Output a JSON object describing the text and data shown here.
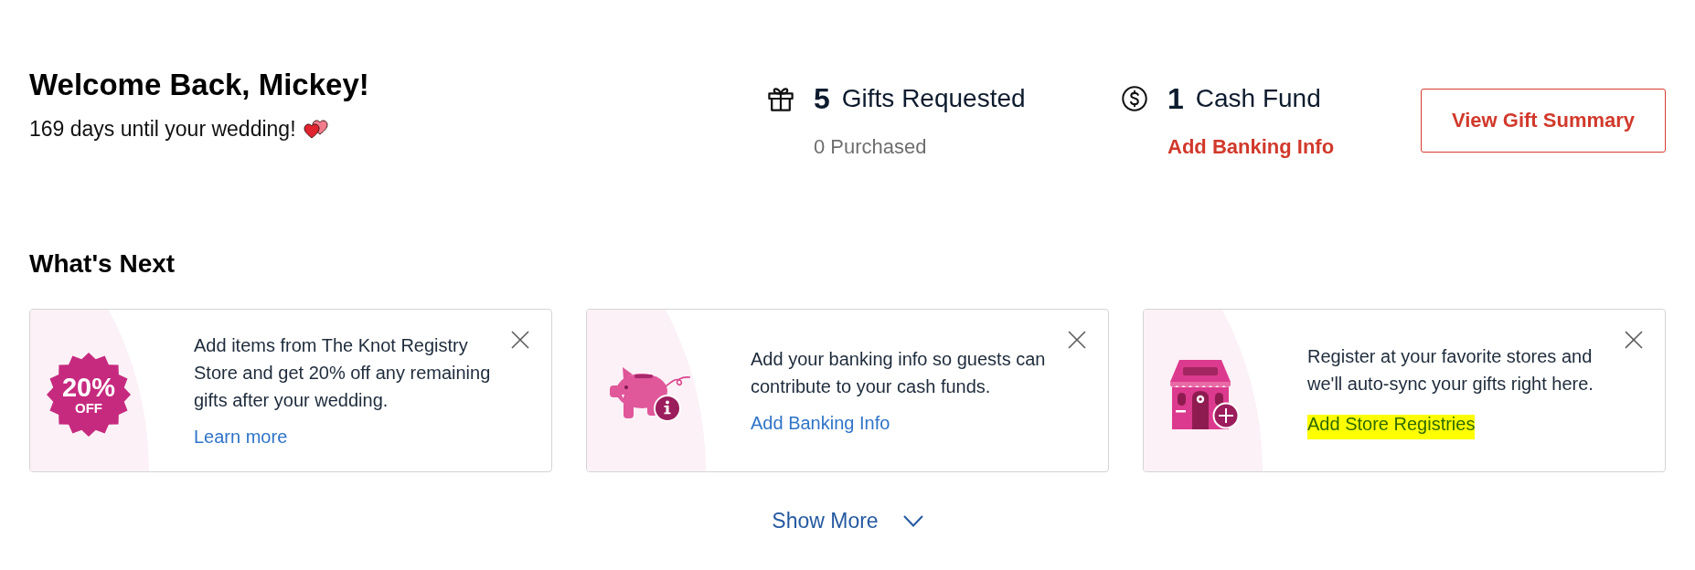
{
  "greeting": {
    "title": "Welcome Back, Mickey!",
    "countdown": "169 days until your wedding!"
  },
  "stats": [
    {
      "kind": "gifts",
      "count": "5",
      "label": "Gifts Requested",
      "detail": {
        "kind": "note",
        "text": "0 Purchased"
      }
    },
    {
      "kind": "cash",
      "count": "1",
      "label": "Cash Fund",
      "detail": {
        "kind": "link",
        "text": "Add Banking Info"
      }
    }
  ],
  "summary_button": {
    "label": "View Gift Summary"
  },
  "whats_next": {
    "title": "What's Next",
    "cards": [
      {
        "kind": "discount",
        "badge": {
          "value": "20%",
          "label": "OFF"
        },
        "text": "Add items from The Knot Registry Store and get 20% off any remaining gifts after your wedding.",
        "link": {
          "label": "Learn more",
          "highlighted": false
        }
      },
      {
        "kind": "banking",
        "text": "Add your banking info so guests can contribute to your cash funds.",
        "link": {
          "label": "Add Banking Info",
          "highlighted": false
        }
      },
      {
        "kind": "stores",
        "text": "Register at your favorite stores and we'll auto-sync your gifts right here.",
        "link": {
          "label": "Add Store Registries",
          "highlighted": true
        }
      }
    ],
    "show_more": "Show More"
  }
}
